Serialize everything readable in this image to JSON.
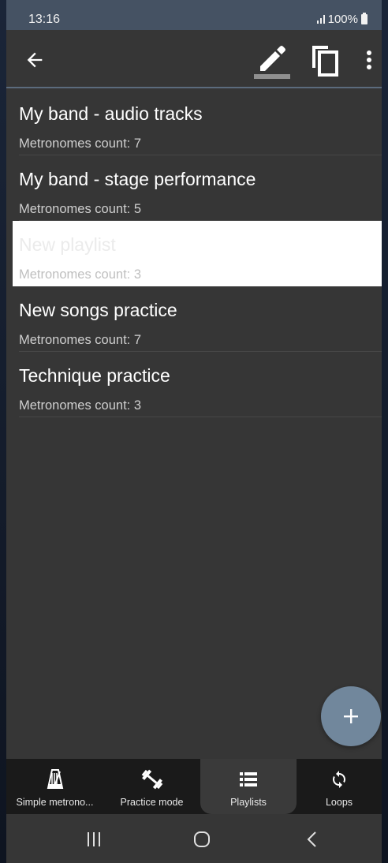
{
  "status_bar": {
    "time": "13:16",
    "battery": "100%"
  },
  "toolbar": {
    "back_icon": "arrow-left-icon",
    "edit_icon": "pencil-icon",
    "copy_icon": "copy-icon",
    "more_icon": "more-vertical-icon"
  },
  "playlists": [
    {
      "name": "My band - audio tracks",
      "count_label": "Metronomes count: 7",
      "selected": false
    },
    {
      "name": "My band - stage performance",
      "count_label": "Metronomes count: 5",
      "selected": false
    },
    {
      "name": "New playlist",
      "count_label": "Metronomes count: 3",
      "selected": true
    },
    {
      "name": "New songs practice",
      "count_label": "Metronomes count: 7",
      "selected": false
    },
    {
      "name": "Technique practice",
      "count_label": "Metronomes count: 3",
      "selected": false
    }
  ],
  "fab": {
    "icon": "plus-icon"
  },
  "bottom_nav": {
    "items": [
      {
        "label": "Simple metrono...",
        "icon": "metronome-icon",
        "active": false
      },
      {
        "label": "Practice mode",
        "icon": "dumbbell-icon",
        "active": false
      },
      {
        "label": "Playlists",
        "icon": "list-icon",
        "active": true
      },
      {
        "label": "Loops",
        "icon": "sync-icon",
        "active": false
      }
    ]
  },
  "colors": {
    "status_bar": "#455263",
    "background": "#363636",
    "selected_row": "#ffffff",
    "fab": "#71879c",
    "bottom_nav": "#1a1a1a"
  }
}
